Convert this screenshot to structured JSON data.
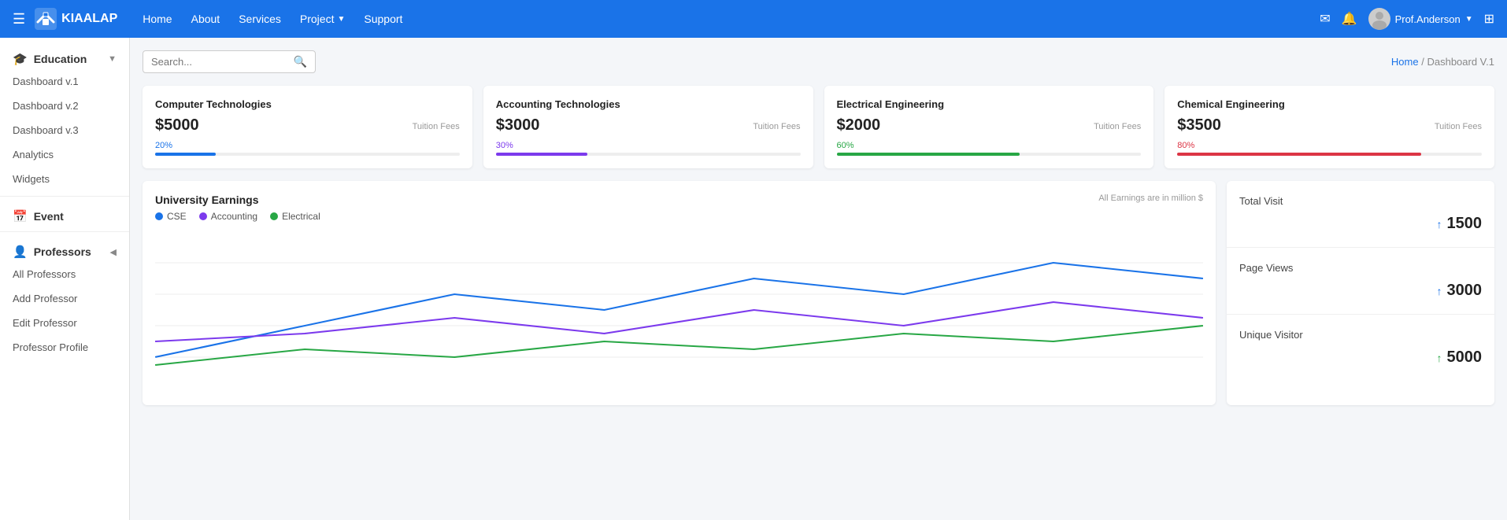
{
  "brand": {
    "name": "KIAALAP"
  },
  "topnav": {
    "hamburger_label": "☰",
    "links": [
      {
        "label": "Home"
      },
      {
        "label": "About"
      },
      {
        "label": "Services"
      },
      {
        "label": "Project",
        "has_dropdown": true
      },
      {
        "label": "Support"
      }
    ],
    "user_name": "Prof.Anderson",
    "mail_icon": "✉",
    "bell_icon": "🔔",
    "grid_icon": "⊞"
  },
  "sidebar": {
    "education_label": "Education",
    "items_education": [
      {
        "label": "Dashboard v.1"
      },
      {
        "label": "Dashboard v.2"
      },
      {
        "label": "Dashboard v.3"
      },
      {
        "label": "Analytics"
      },
      {
        "label": "Widgets"
      }
    ],
    "event_label": "Event",
    "professors_label": "Professors",
    "items_professors": [
      {
        "label": "All Professors"
      },
      {
        "label": "Add Professor"
      },
      {
        "label": "Edit Professor"
      },
      {
        "label": "Professor Profile"
      }
    ]
  },
  "topbar": {
    "search_placeholder": "Search...",
    "breadcrumb_home": "Home",
    "breadcrumb_separator": "/",
    "breadcrumb_current": "Dashboard V.1"
  },
  "cards": [
    {
      "title": "Computer Technologies",
      "value": "$5000",
      "label": "Tuition Fees",
      "progress_pct": 20,
      "progress_label": "20%",
      "progress_color": "#1a73e8"
    },
    {
      "title": "Accounting Technologies",
      "value": "$3000",
      "label": "Tuition Fees",
      "progress_pct": 30,
      "progress_label": "30%",
      "progress_color": "#7c3aed"
    },
    {
      "title": "Electrical Engineering",
      "value": "$2000",
      "label": "Tuition Fees",
      "progress_pct": 60,
      "progress_label": "60%",
      "progress_color": "#28a745"
    },
    {
      "title": "Chemical Engineering",
      "value": "$3500",
      "label": "Tuition Fees",
      "progress_pct": 80,
      "progress_label": "80%",
      "progress_color": "#dc3545"
    }
  ],
  "earnings_chart": {
    "title": "University Earnings",
    "subtitle": "All Earnings are in million $",
    "legend": [
      {
        "label": "CSE",
        "color": "#1a73e8"
      },
      {
        "label": "Accounting",
        "color": "#7c3aed"
      },
      {
        "label": "Electrical",
        "color": "#28a745"
      }
    ]
  },
  "stats": [
    {
      "label": "Total Visit",
      "value": "1500",
      "arrow": "↑",
      "arrow_color": "blue"
    },
    {
      "label": "Page Views",
      "value": "3000",
      "arrow": "↑",
      "arrow_color": "blue"
    },
    {
      "label": "Unique Visitor",
      "value": "5000",
      "arrow": "↑",
      "arrow_color": "green"
    }
  ]
}
